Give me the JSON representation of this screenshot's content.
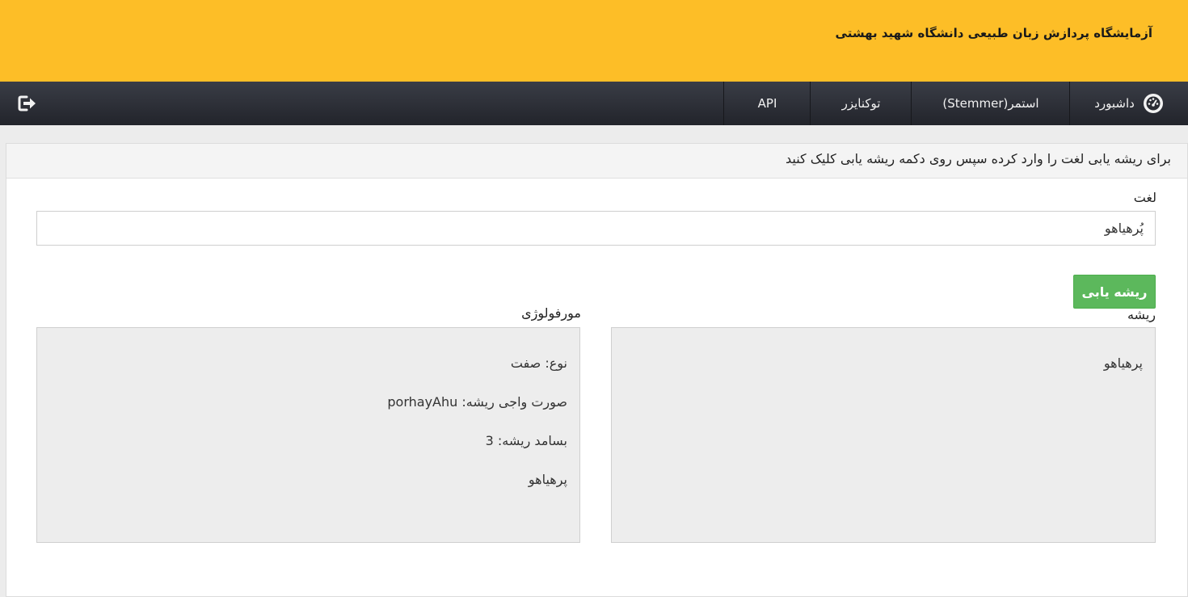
{
  "header": {
    "title": "آزمایشگاه پردازش زبان طبیعی دانشگاه شهید بهشتی"
  },
  "navbar": {
    "items": [
      {
        "label": "داشبورد",
        "icon": "gauge-icon"
      },
      {
        "label": "استمر(Stemmer)"
      },
      {
        "label": "توکنایزر"
      },
      {
        "label": "API"
      }
    ],
    "logout_icon": "sign-out-icon"
  },
  "panel": {
    "heading": "برای ریشه یابی لغت را وارد کرده سپس روی دکمه ریشه یابی کلیک کنید",
    "word_label": "لغت",
    "word_value": "پُرهیاهو",
    "stem_button": "ریشه یابی",
    "root_label": "ریشه",
    "root_value": "پرهیاهو",
    "morphology_label": "مورفولوژی",
    "morphology_lines": [
      "نوع: صفت",
      "صورت واجی ریشه: porhayAhu",
      "بسامد ریشه: 3",
      "پرهیاهو",
      "",
      "******************************"
    ]
  },
  "colors": {
    "header_bg": "#fdbe27",
    "navbar_bg": "#2a2c33",
    "button_green": "#5cb85c",
    "textarea_bg": "#ededed"
  }
}
